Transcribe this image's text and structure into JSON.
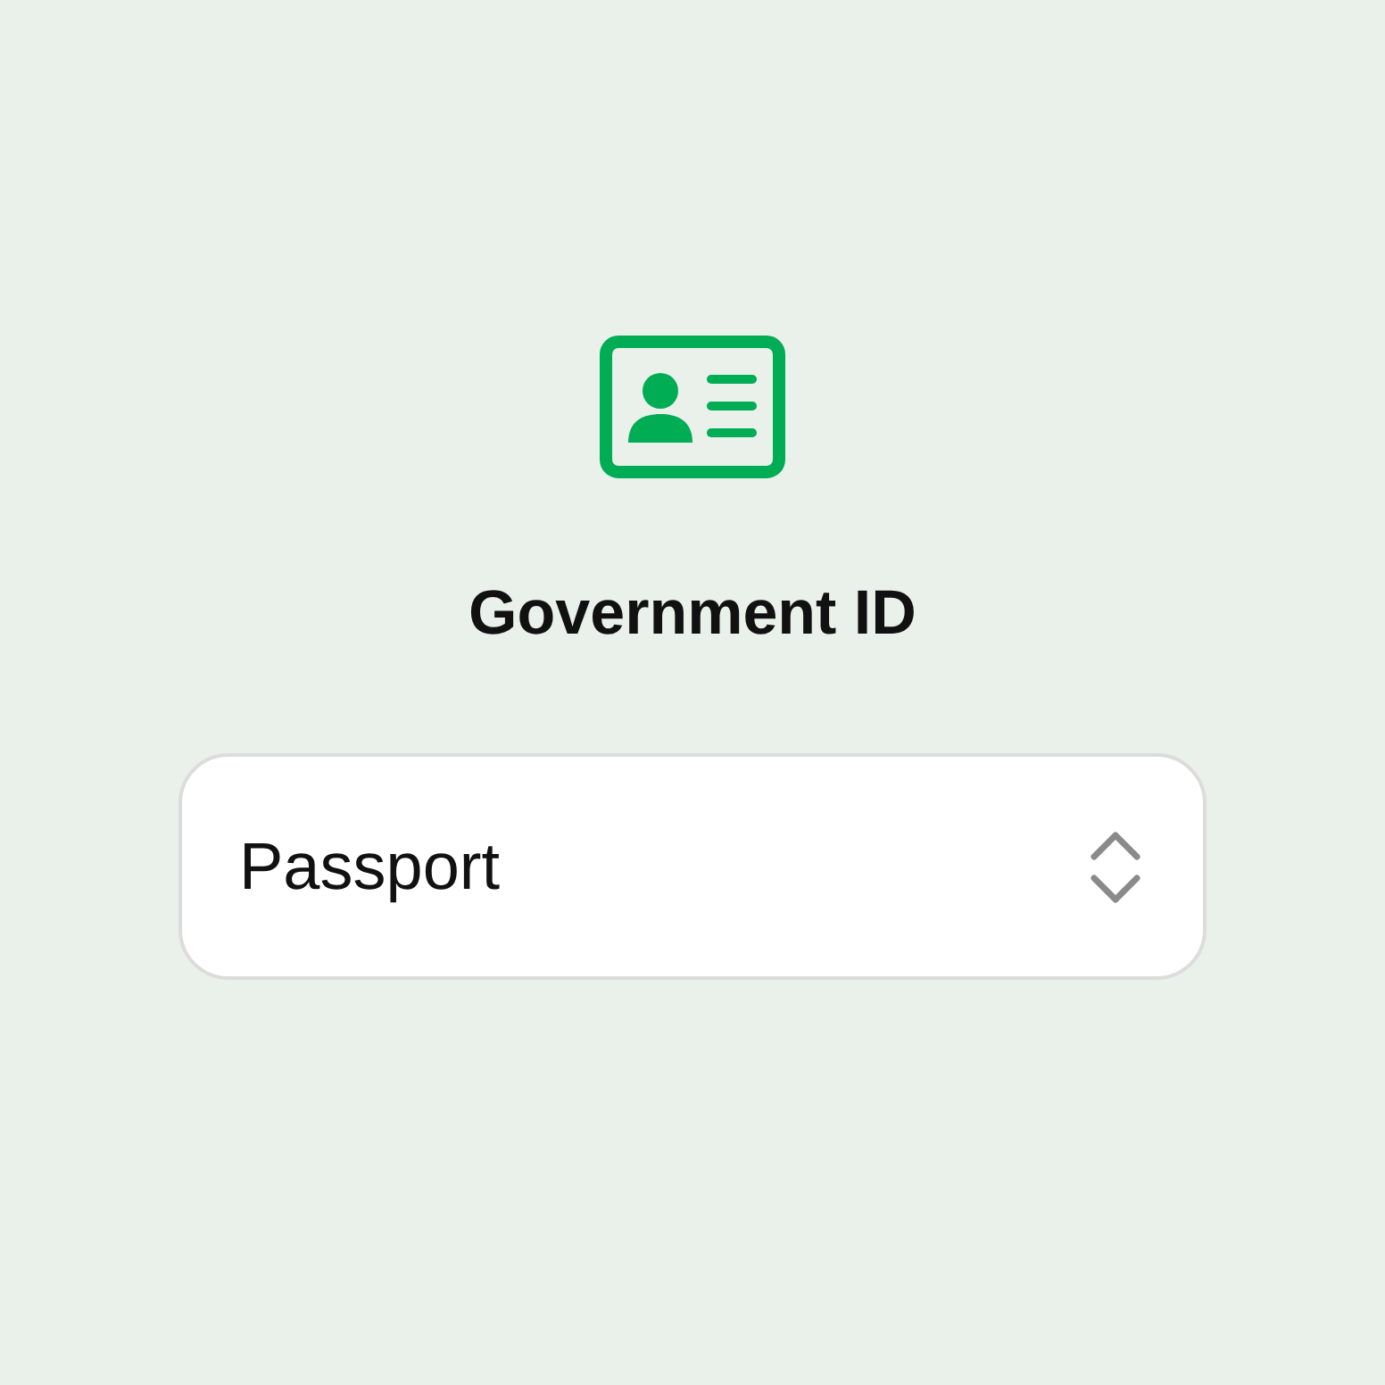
{
  "title": "Government ID",
  "select": {
    "value": "Passport"
  }
}
